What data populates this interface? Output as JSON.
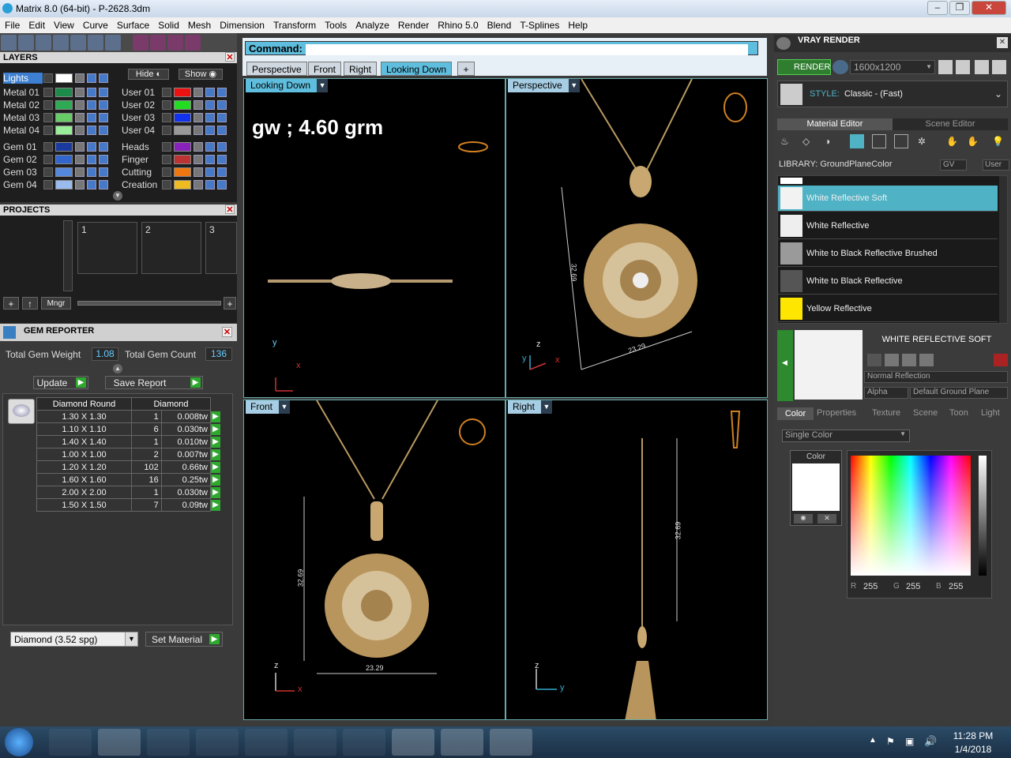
{
  "window": {
    "title": "Matrix 8.0 (64-bit) - P-2628.3dm"
  },
  "menu": [
    "File",
    "Edit",
    "View",
    "Curve",
    "Surface",
    "Solid",
    "Mesh",
    "Dimension",
    "Transform",
    "Tools",
    "Analyze",
    "Render",
    "Rhino 5.0",
    "Blend",
    "T-Splines",
    "Help"
  ],
  "layers": {
    "title": "LAYERS",
    "hide": "Hide",
    "show": "Show",
    "left": [
      {
        "name": "Lights",
        "color": "#ffffff"
      },
      {
        "name": "Metal 01",
        "color": "#1c8a4a"
      },
      {
        "name": "Metal 02",
        "color": "#2eaa55"
      },
      {
        "name": "Metal 03",
        "color": "#66cc66"
      },
      {
        "name": "Metal 04",
        "color": "#99ee99"
      },
      {
        "name": "Gem 01",
        "color": "#1a3aa0"
      },
      {
        "name": "Gem 02",
        "color": "#3366cc"
      },
      {
        "name": "Gem 03",
        "color": "#5588dd"
      },
      {
        "name": "Gem 04",
        "color": "#99bbee"
      }
    ],
    "right": [
      {
        "name": "User 01",
        "color": "#ee1111"
      },
      {
        "name": "User 02",
        "color": "#22dd22"
      },
      {
        "name": "User 03",
        "color": "#1133ee"
      },
      {
        "name": "User 04",
        "color": "#999999"
      },
      {
        "name": "Heads",
        "color": "#8822bb"
      },
      {
        "name": "Finger",
        "color": "#bb3333"
      },
      {
        "name": "Cutting",
        "color": "#ee7711"
      },
      {
        "name": "Creation",
        "color": "#eebb22"
      }
    ]
  },
  "projects": {
    "title": "PROJECTS",
    "slots": [
      "1",
      "2",
      "3"
    ],
    "mngr": "Mngr"
  },
  "gem_reporter": {
    "title": "GEM REPORTER",
    "total_weight_label": "Total Gem Weight",
    "total_weight": "1.08",
    "total_count_label": "Total Gem Count",
    "total_count": "136",
    "update": "Update",
    "save_report": "Save Report",
    "col1": "Diamond Round",
    "col2": "Diamond",
    "rows": [
      [
        "1.30 X 1.30",
        "1",
        "0.008tw"
      ],
      [
        "1.10 X 1.10",
        "6",
        "0.030tw"
      ],
      [
        "1.40 X 1.40",
        "1",
        "0.010tw"
      ],
      [
        "1.00 X 1.00",
        "2",
        "0.007tw"
      ],
      [
        "1.20 X 1.20",
        "102",
        "0.66tw"
      ],
      [
        "1.60 X 1.60",
        "16",
        "0.25tw"
      ],
      [
        "2.00 X 2.00",
        "1",
        "0.030tw"
      ],
      [
        "1.50 X 1.50",
        "7",
        "0.09tw"
      ]
    ],
    "material": "Diamond     (3.52 spg)",
    "set_material": "Set Material"
  },
  "command": {
    "label": "Command:"
  },
  "view_tabs": [
    "Perspective",
    "Front",
    "Right",
    "Looking Down"
  ],
  "viewports": {
    "top_left": "Looking Down",
    "top_right": "Perspective",
    "bottom_left": "Front",
    "bottom_right": "Right"
  },
  "annotation": "gw ; 4.60 grm",
  "dims": {
    "width": "23.29",
    "height": "32.69",
    "side": "32.69"
  },
  "axes": {
    "x": "x",
    "y": "y",
    "z": "z"
  },
  "vray": {
    "title": "VRAY RENDER",
    "render": "RENDER",
    "resolution": "1600x1200",
    "style_label": "STYLE:",
    "style": "Classic - (Fast)",
    "tabs": [
      "Material Editor",
      "Scene Editor"
    ],
    "library": "LIBRARY: GroundPlaneColor",
    "gv": "GV",
    "user": "User",
    "materials": [
      {
        "name": "White Reflective Soft",
        "color": "#f2f2f2"
      },
      {
        "name": "White Reflective",
        "color": "#eeeeee"
      },
      {
        "name": "White to Black Reflective Brushed",
        "color": "#9a9a9a"
      },
      {
        "name": "White to Black Reflective",
        "color": "#555555"
      },
      {
        "name": "Yellow Reflective",
        "color": "#ffe600"
      }
    ],
    "selected_title": "WHITE REFLECTIVE SOFT",
    "reflection": "Normal Reflection",
    "alpha": "Alpha",
    "ground": "Default Ground Plane",
    "prop_tabs": [
      "Color",
      "Properties",
      "Texture",
      "Scene",
      "Toon",
      "Light"
    ],
    "color_mode": "Single Color",
    "color_label": "Color",
    "rgb": {
      "r": "255",
      "g": "255",
      "b": "255"
    }
  },
  "clock": {
    "time": "11:28 PM",
    "date": "1/4/2018"
  }
}
